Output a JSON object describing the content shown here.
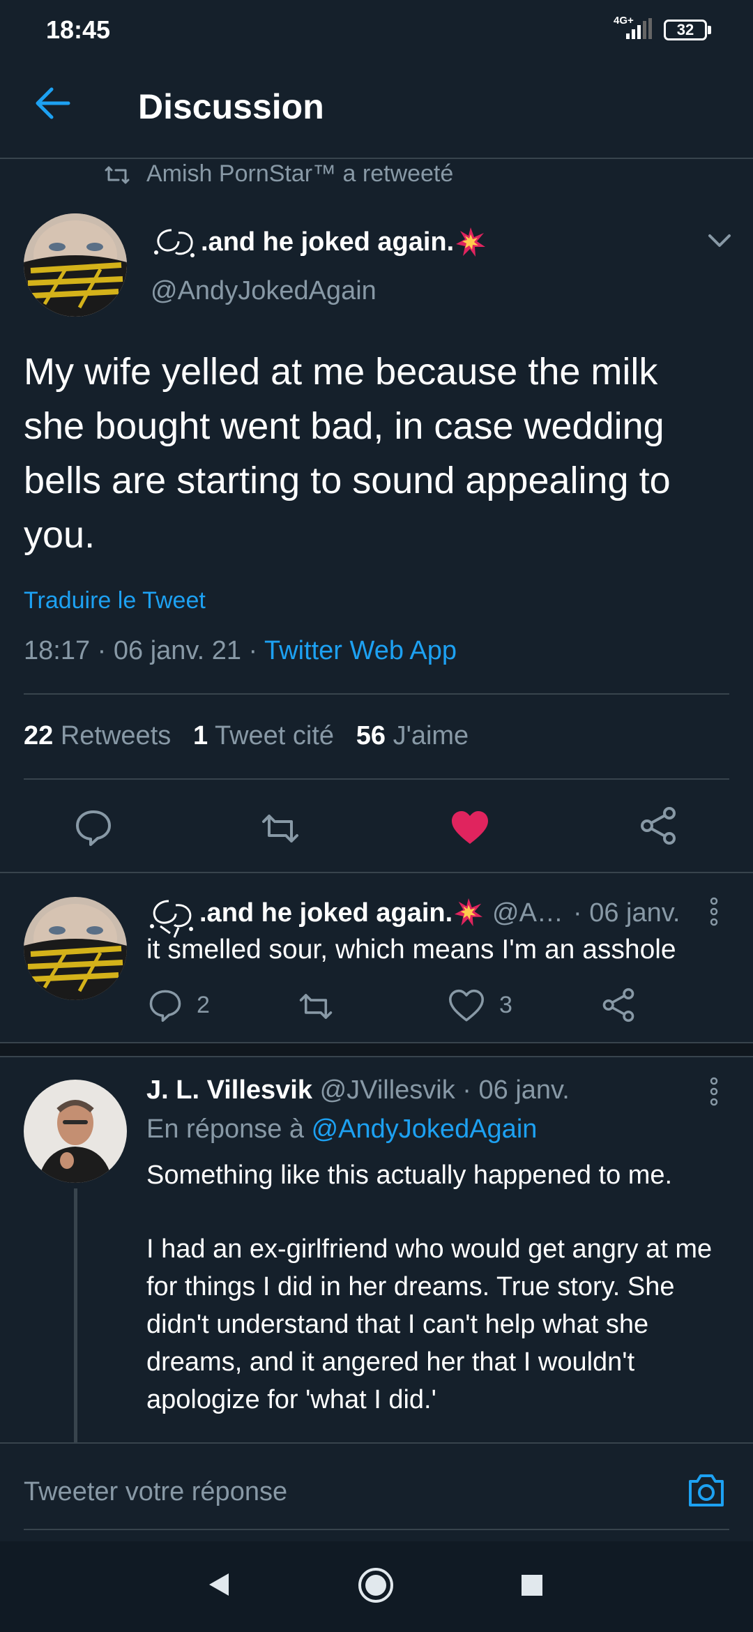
{
  "status": {
    "time": "18:45",
    "network": "4G+",
    "battery": "32"
  },
  "header": {
    "title": "Discussion"
  },
  "retweet_banner": {
    "text": "Amish PornStar™ a retweeté"
  },
  "main_tweet": {
    "display_name": ".and he joked again.",
    "handle": "@AndyJokedAgain",
    "text": "My wife yelled at me because the milk she bought went bad, in case wedding bells are starting to sound appealing to you.",
    "translate": "Traduire le Tweet",
    "timestamp": "18:17 · 06 janv. 21 · ",
    "source": "Twitter Web App",
    "stats": {
      "retweets_count": "22",
      "retweets_label": "Retweets",
      "quotes_count": "1",
      "quotes_label": "Tweet cité",
      "likes_count": "56",
      "likes_label": "J'aime"
    }
  },
  "replies": [
    {
      "display_name": ".and he joked again.",
      "handle": "@A…",
      "date": "· 06 janv.",
      "text": "it smelled sour, which means I'm an asshole",
      "reply_count": "2",
      "like_count": "3"
    },
    {
      "display_name": "J. L. Villesvik",
      "handle": "@JVillesvik",
      "date": "· 06 janv.",
      "reply_prefix": "En réponse à ",
      "reply_to": "@AndyJokedAgain",
      "text_p1": "Something like this actually happened to me.",
      "text_p2": "I had an ex-girlfriend who would get angry at me for things I did in her dreams. True story. She didn't understand that I can't help what she dreams, and it angered her that I wouldn't apologize for 'what I did.'"
    }
  ],
  "compose": {
    "placeholder": "Tweeter votre réponse"
  },
  "colors": {
    "background": "#15202b",
    "accent": "#1da1f2",
    "like": "#e0245e",
    "muted": "#8899a6"
  }
}
